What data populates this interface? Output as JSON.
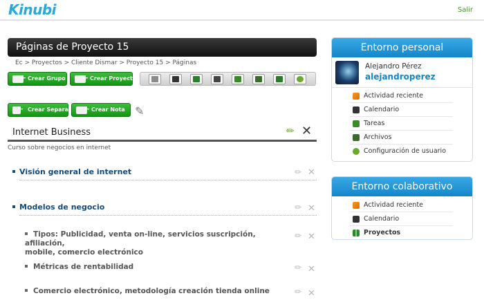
{
  "header": {
    "logo": "Kinubi",
    "logout": "Salir"
  },
  "page": {
    "title": "Páginas de Proyecto 15",
    "breadcrumb": "Ec > Proyectos > Cliente Dismar > Proyecto 15 > Páginas"
  },
  "buttons": {
    "create_group": "Crear Grupo",
    "create_project": "Crear Proyecto",
    "create_separator": "Crear Separador",
    "create_note": "Crear Nota"
  },
  "toolbar_icons": [
    "calculator-icon",
    "calendar-icon",
    "chat-icon",
    "document-icon",
    "tasks-icon",
    "folder-icon",
    "users-icon",
    "settings-icon"
  ],
  "section": {
    "title": "Internet Business",
    "description": "Curso sobre negocios en internet"
  },
  "items": [
    {
      "label": "Visión general de internet"
    },
    {
      "label": "Modelos de negocio"
    }
  ],
  "subitems": [
    {
      "line1": "Tipos: Publicidad, venta on-line, servicios suscripción, afiliación,",
      "line2": "mobile, comercio electrónico"
    },
    {
      "line1": "Métricas de rentabilidad"
    },
    {
      "line1": "Comercio electrónico, metodología creación tienda online"
    }
  ],
  "personal_panel": {
    "title": "Entorno personal",
    "user_name": "Alejandro Pérez",
    "username": "alejandroperez",
    "menu": [
      {
        "label": "Actividad reciente",
        "icon": "rss-icon"
      },
      {
        "label": "Calendario",
        "icon": "calendar-icon"
      },
      {
        "label": "Tareas",
        "icon": "tasks-icon"
      },
      {
        "label": "Archivos",
        "icon": "folder-icon"
      },
      {
        "label": "Configuración de usuario",
        "icon": "user-settings-icon"
      }
    ]
  },
  "collab_panel": {
    "title": "Entorno colaborativo",
    "menu": [
      {
        "label": "Actividad reciente",
        "icon": "rss-icon"
      },
      {
        "label": "Calendario",
        "icon": "calendar-icon"
      },
      {
        "label": "Proyectos",
        "icon": "projects-icon"
      }
    ]
  },
  "colors": {
    "accent_blue": "#1486c8",
    "accent_green": "#159515",
    "link_green": "#3a9b1e"
  }
}
